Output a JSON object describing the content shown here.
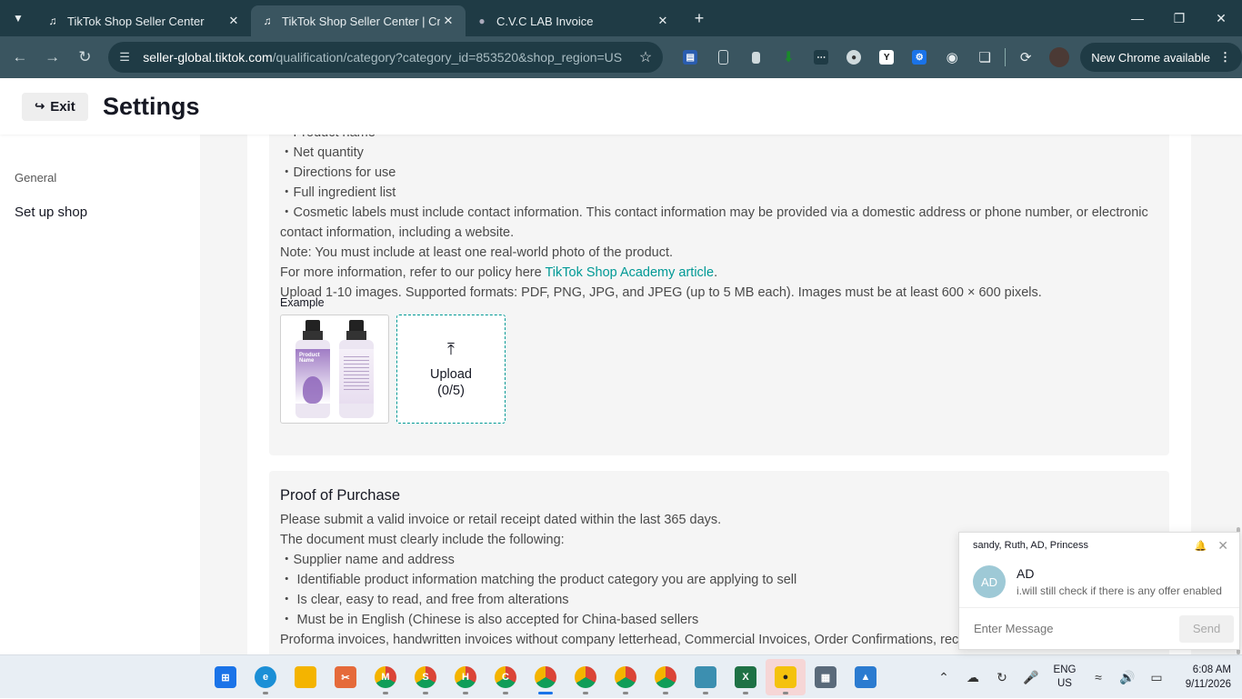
{
  "browser": {
    "tabs": [
      {
        "title": "TikTok Shop Seller Center",
        "icon": "tiktok-icon",
        "active": false
      },
      {
        "title": "TikTok Shop Seller Center | Cros",
        "icon": "tiktok-icon",
        "active": true
      },
      {
        "title": "C.V.C LAB Invoice",
        "icon": "globe-icon",
        "active": false
      }
    ],
    "url_host": "seller-global.tiktok.com",
    "url_path": "/qualification/category?category_id=853520&shop_region=US",
    "update_label": "New Chrome available"
  },
  "header": {
    "exit_label": "Exit",
    "title": "Settings"
  },
  "sidebar": {
    "section": "General",
    "item": "Set up shop"
  },
  "card1": {
    "lines": [
      "・Product name",
      "・Net quantity",
      "・Directions for use",
      "・Full ingredient list",
      "・Cosmetic labels must include contact information. This contact information may be provided via a domestic address or phone number, or electronic contact information, including a website.",
      "Note: You must include at least one real-world photo of the product."
    ],
    "policy_prefix": "For more information, refer to our policy here ",
    "policy_link": "TikTok Shop Academy article",
    "policy_suffix": ".",
    "upload_rules": "Upload 1-10 images. Supported formats: PDF, PNG, JPG, and JPEG (up to 5 MB each). Images must be at least 600 × 600 pixels.",
    "example_label": "Example",
    "product_tag": "Product Name",
    "upload_label": "Upload",
    "upload_count": "(0/5)"
  },
  "card2": {
    "heading": "Proof of Purchase",
    "lines": [
      "Please submit a valid invoice or retail receipt dated within the last 365 days.",
      "The document must clearly include the following:",
      "・Supplier name and address",
      "・ Identifiable product information matching the product category you are applying to sell",
      "・ Is clear, easy to read, and free from alterations",
      "・ Must be in English (Chinese is also accepted for China-based sellers",
      "Proforma invoices, handwritten invoices without company letterhead, Commercial Invoices, Order Confirmations, receipts from e-commerce platforms"
    ]
  },
  "chat": {
    "participants": "sandy, Ruth, AD, Princess",
    "avatar": "AD",
    "name": "AD",
    "last_message": "i.will still check if there is any offer enabled",
    "placeholder": "Enter Message",
    "send_label": "Send"
  },
  "taskbar": {
    "lang_top": "ENG",
    "lang_bottom": "US",
    "time": "6:08 AM",
    "date": "9/11/2026"
  },
  "colors": {
    "accent": "#009995",
    "tabbar": "#1f3b45",
    "toolbar": "#3a5560"
  }
}
